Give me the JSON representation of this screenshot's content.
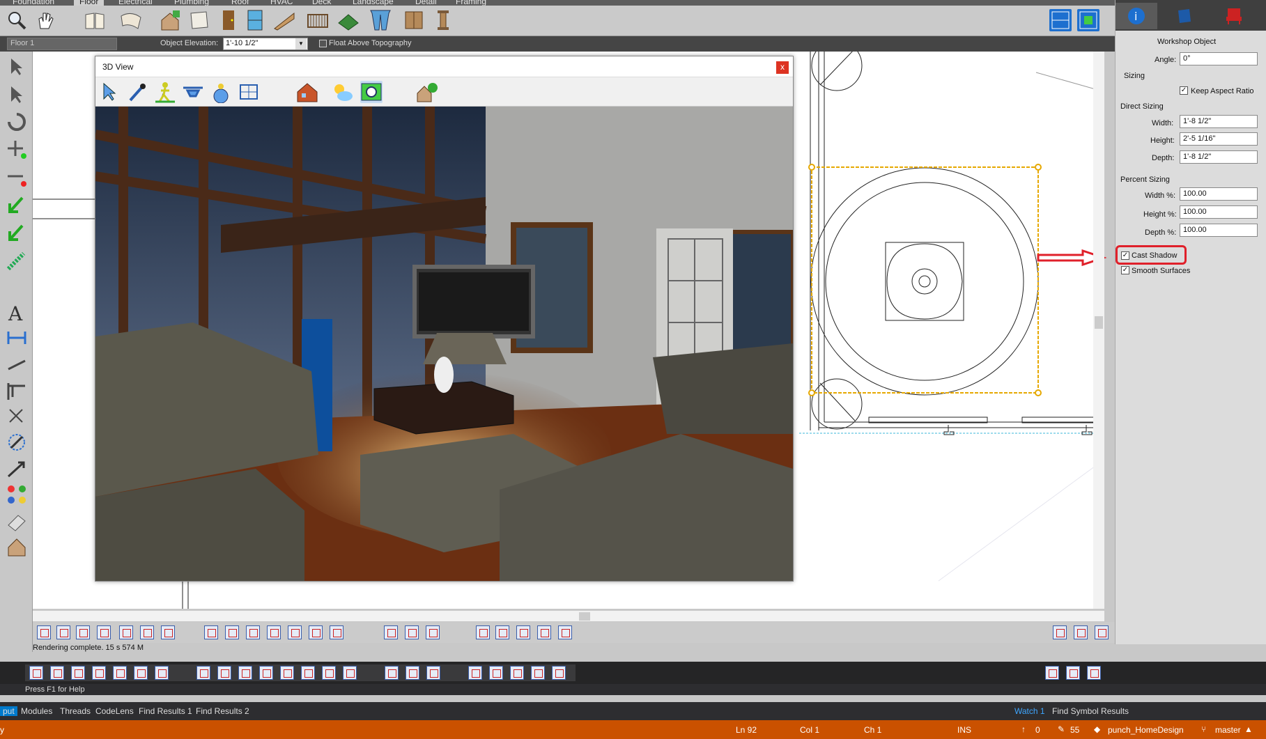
{
  "menu": {
    "tabs": [
      "Foundation",
      "Floor",
      "Electrical",
      "Plumbing",
      "Roof",
      "HVAC",
      "Deck",
      "Landscape",
      "Detail",
      "Framing"
    ],
    "active": "Floor"
  },
  "options_bar": {
    "floor": "Floor 1",
    "elevation_label": "Object Elevation:",
    "elevation_value": "1'-10 1/2\"",
    "float_label": "Float Above Topography"
  },
  "view3d": {
    "title": "3D View",
    "close": "x"
  },
  "panel": {
    "title": "Workshop Object",
    "angle_label": "Angle:",
    "angle_value": "0°",
    "sizing_label": "Sizing",
    "keep_aspect": "Keep Aspect Ratio",
    "direct_label": "Direct Sizing",
    "width_label": "Width:",
    "width_value": "1'-8 1/2\"",
    "height_label": "Height:",
    "height_value": "2'-5 1/16\"",
    "depth_label": "Depth:",
    "depth_value": "1'-8 1/2\"",
    "percent_label": "Percent Sizing",
    "wpct_label": "Width %:",
    "wpct_value": "100.00",
    "hpct_label": "Height %:",
    "hpct_value": "100.00",
    "dpct_label": "Depth %:",
    "dpct_value": "100.00",
    "cast_shadow": "Cast Shadow",
    "smooth": "Smooth Surfaces"
  },
  "status": {
    "render": "Rendering complete.  15 s 574 M",
    "help": "Press F1 for Help"
  },
  "vs_tabs": {
    "left": [
      "put",
      "Modules",
      "Threads",
      "CodeLens",
      "Find Results 1",
      "Find Results 2"
    ],
    "right": [
      "Watch 1",
      "Find Symbol Results"
    ]
  },
  "vs_status": {
    "left": "y",
    "ln": "Ln 92",
    "col": "Col 1",
    "ch": "Ch 1",
    "ins": "INS",
    "up": "0",
    "edits": "55",
    "repo": "punch_HomeDesign",
    "branch": "master"
  },
  "colors": {
    "accent": "#ca5100",
    "selection": "#e6a800",
    "highlight": "#e0202a"
  }
}
